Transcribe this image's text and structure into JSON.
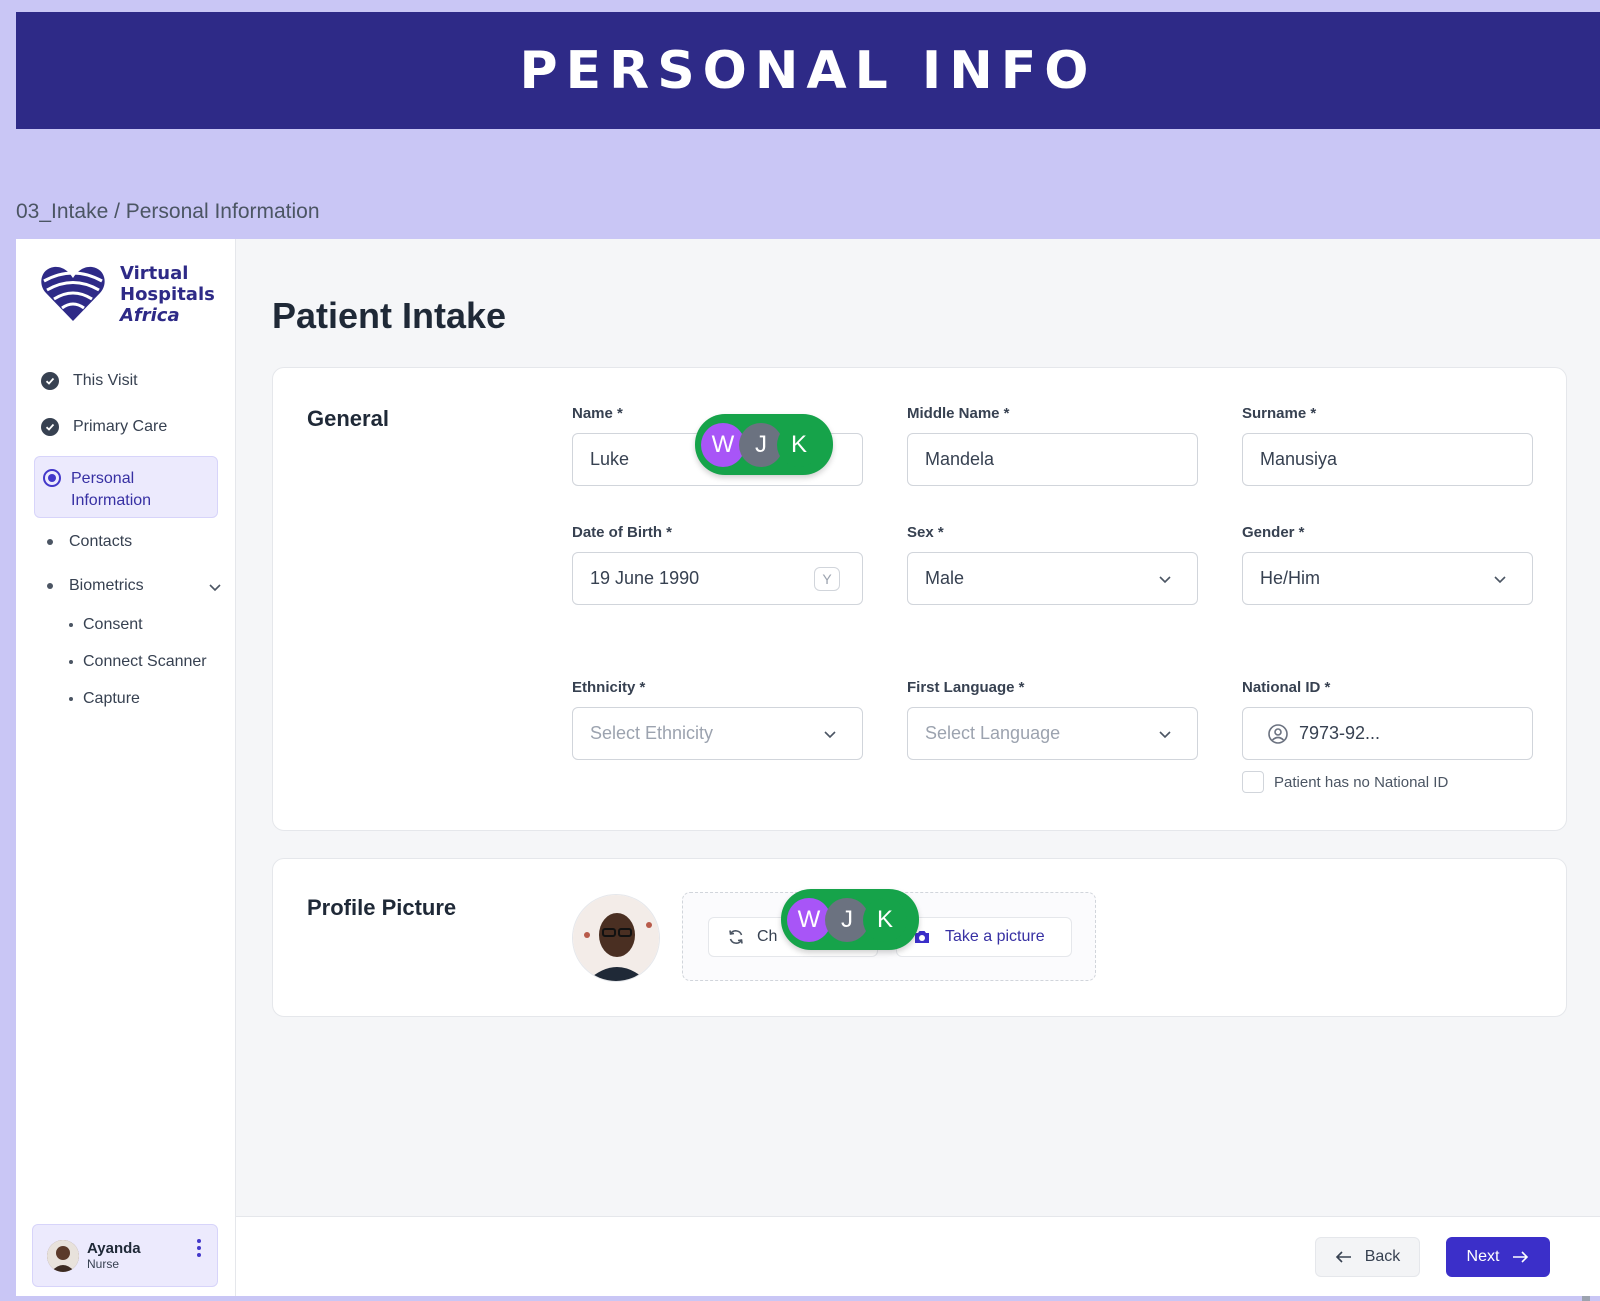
{
  "banner": {
    "title": "PERSONAL INFO"
  },
  "breadcrumb": "03_Intake / Personal Information",
  "brand": {
    "line1": "Virtual",
    "line2": "Hospitals",
    "line3": "Africa"
  },
  "nav": {
    "this_visit": "This Visit",
    "primary_care": "Primary Care",
    "personal_info_1": "Personal",
    "personal_info_2": "Information",
    "contacts": "Contacts",
    "biometrics": "Biometrics",
    "consent": "Consent",
    "connect_scanner": "Connect Scanner",
    "capture": "Capture"
  },
  "user": {
    "name": "Ayanda",
    "role": "Nurse"
  },
  "page": {
    "title": "Patient Intake"
  },
  "general": {
    "title": "General",
    "name_label": "Name *",
    "name_value": "Luke",
    "middle_label": "Middle Name *",
    "middle_value": "Mandela",
    "surname_label": "Surname *",
    "surname_value": "Manusiya",
    "dob_label": "Date of Birth *",
    "dob_value": "19 June 1990",
    "dob_toggle": "Y",
    "sex_label": "Sex *",
    "sex_value": "Male",
    "gender_label": "Gender *",
    "gender_value": "He/Him",
    "ethnicity_label": "Ethnicity *",
    "ethnicity_placeholder": "Select Ethnicity",
    "language_label": "First Language *",
    "language_placeholder": "Select Language",
    "national_id_label": "National ID *",
    "national_id_value": "7973-92...",
    "no_id_label": "Patient has no National ID"
  },
  "profile": {
    "title": "Profile Picture",
    "change_label": "Ch",
    "take_picture_label": "Take a picture"
  },
  "presence": {
    "w": "W",
    "j": "J",
    "k": "K"
  },
  "footer": {
    "back_label": "Back",
    "next_label": "Next"
  },
  "colors": {
    "brand": "#2e2a87",
    "accent": "#3b2fc9",
    "presence": "#16a34a",
    "background": "#c9c6f5"
  }
}
